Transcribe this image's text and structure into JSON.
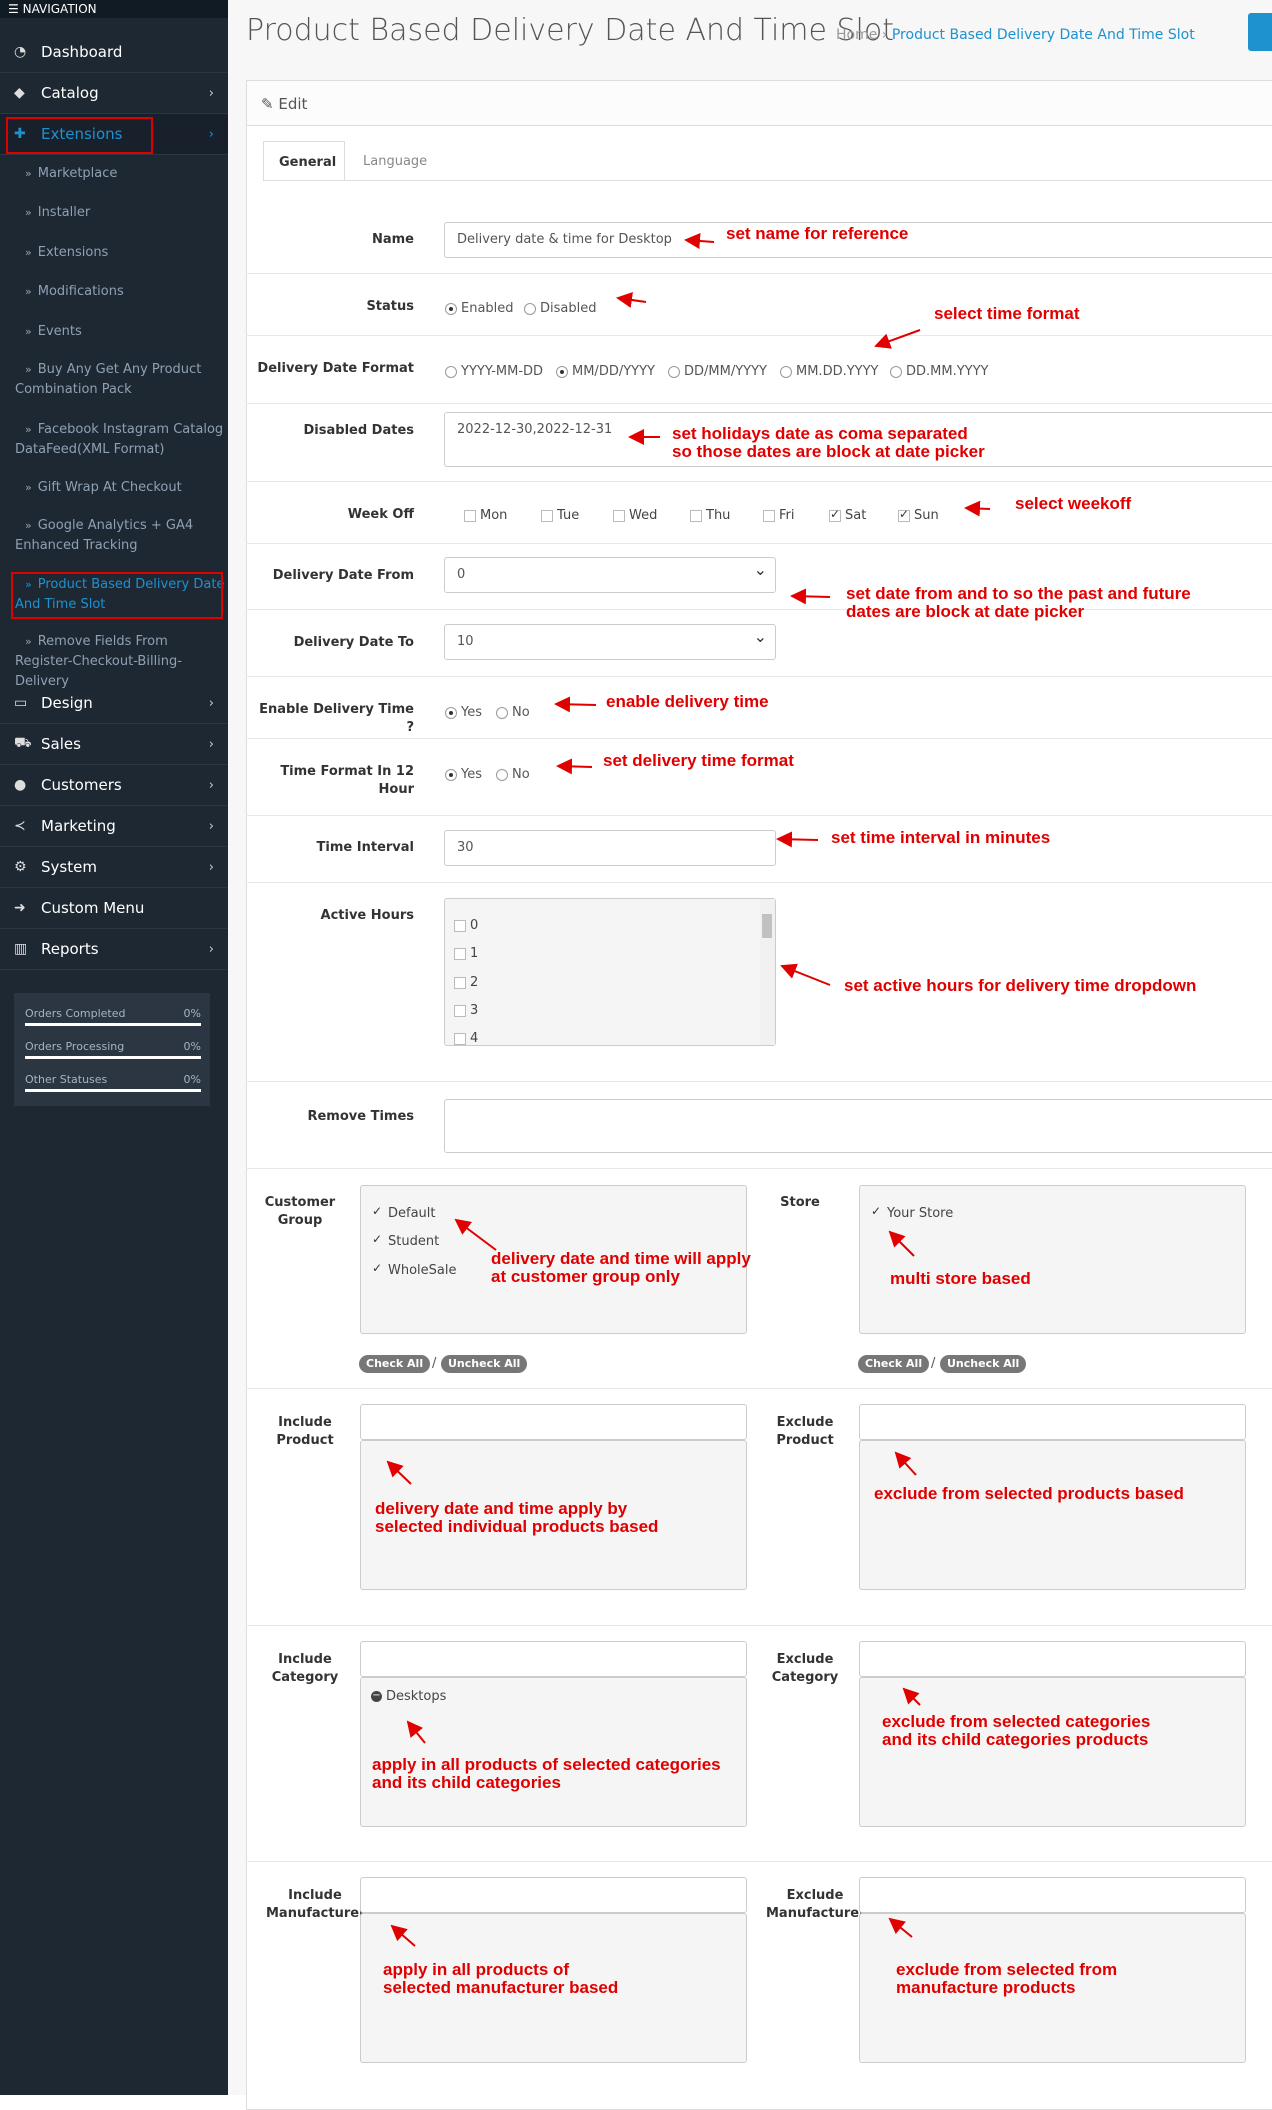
{
  "sidebar": {
    "nav_heading": "NAVIGATION",
    "menu": [
      {
        "label": "Dashboard",
        "icon": "dashboard-icon",
        "has_children": false
      },
      {
        "label": "Catalog",
        "icon": "tags-icon",
        "has_children": true
      },
      {
        "label": "Extensions",
        "icon": "puzzle-icon",
        "has_children": true
      },
      {
        "label": "Design",
        "icon": "desktop-icon",
        "has_children": true
      },
      {
        "label": "Sales",
        "icon": "cart-icon",
        "has_children": true
      },
      {
        "label": "Customers",
        "icon": "user-icon",
        "has_children": true
      },
      {
        "label": "Marketing",
        "icon": "share-icon",
        "has_children": true
      },
      {
        "label": "System",
        "icon": "gear-icon",
        "has_children": true
      },
      {
        "label": "Custom Menu",
        "icon": "arrow-right-icon",
        "has_children": false
      },
      {
        "label": "Reports",
        "icon": "bar-chart-icon",
        "has_children": true
      }
    ],
    "extensions_sub": [
      "Marketplace",
      "Installer",
      "Extensions",
      "Modifications",
      "Events",
      "Buy Any Get Any Product Combination Pack",
      "Facebook Instagram Catalog DataFeed(XML Format)",
      "Gift Wrap At Checkout",
      "Google Analytics + GA4 Enhanced Tracking",
      "Product Based Delivery Date And Time Slot",
      "Remove Fields From Register-Checkout-Billing-Delivery"
    ],
    "stats": [
      {
        "label": "Orders Completed",
        "value": "0%"
      },
      {
        "label": "Orders Processing",
        "value": "0%"
      },
      {
        "label": "Other Statuses",
        "value": "0%"
      }
    ]
  },
  "header": {
    "title": "Product Based Delivery Date And Time Slot",
    "breadcrumb": [
      "Home",
      "Product Based Delivery Date And Time Slot"
    ],
    "breadcrumb_sep": "›"
  },
  "panel": {
    "heading": "Edit",
    "tabs": [
      "General",
      "Language"
    ]
  },
  "form": {
    "name": {
      "label": "Name",
      "value": "Delivery date & time for Desktop"
    },
    "status": {
      "label": "Status",
      "options": [
        "Enabled",
        "Disabled"
      ],
      "selected": "Enabled"
    },
    "date_format": {
      "label": "Delivery Date Format",
      "options": [
        "YYYY-MM-DD",
        "MM/DD/YYYY",
        "DD/MM/YYYY",
        "MM.DD.YYYY",
        "DD.MM.YYYY"
      ],
      "selected": "MM/DD/YYYY"
    },
    "disabled_dates": {
      "label": "Disabled Dates",
      "value": "2022-12-30,2022-12-31"
    },
    "week_off": {
      "label": "Week Off",
      "days": [
        "Mon",
        "Tue",
        "Wed",
        "Thu",
        "Fri",
        "Sat",
        "Sun"
      ],
      "checked": [
        "Sat",
        "Sun"
      ]
    },
    "date_from": {
      "label": "Delivery Date From",
      "value": "0"
    },
    "date_to": {
      "label": "Delivery Date To",
      "value": "10"
    },
    "enable_time": {
      "label": "Enable Delivery Time ?",
      "options": [
        "Yes",
        "No"
      ],
      "selected": "Yes"
    },
    "time_format": {
      "label_line1": "Time Format In 12",
      "label_line2": "Hour",
      "options": [
        "Yes",
        "No"
      ],
      "selected": "Yes"
    },
    "time_interval": {
      "label": "Time Interval",
      "value": "30"
    },
    "active_hours": {
      "label": "Active Hours",
      "items": [
        "0",
        "1",
        "2",
        "3",
        "4"
      ]
    },
    "remove_times": {
      "label": "Remove Times",
      "value": ""
    },
    "customer_group": {
      "label_line1": "Customer",
      "label_line2": "Group",
      "items": [
        "Default",
        "Student",
        "WholeSale"
      ]
    },
    "store": {
      "label": "Store",
      "items": [
        "Your Store"
      ]
    },
    "check_all": "Check All",
    "uncheck_all": "Uncheck All",
    "slash": "/",
    "include_product": {
      "label_line1": "Include",
      "label_line2": "Product"
    },
    "exclude_product": {
      "label_line1": "Exclude",
      "label_line2": "Product"
    },
    "include_category": {
      "label_line1": "Include",
      "label_line2": "Category",
      "items": [
        "Desktops"
      ]
    },
    "exclude_category": {
      "label_line1": "Exclude",
      "label_line2": "Category"
    },
    "include_manufacturer": {
      "label_line1": "Include",
      "label_line2": "Manufacturer"
    },
    "exclude_manufacturer": {
      "label_line1": "Exclude",
      "label_line2": "Manufacturer"
    }
  },
  "annotations": {
    "name": "set name for reference",
    "time_format": "select time format",
    "holidays_1": "set holidays date as coma separated",
    "holidays_2": "so those dates are block at date picker",
    "weekoff": "select weekoff",
    "date_range_1": "set date from and to so the past and future",
    "date_range_2": "dates are block at date picker",
    "enable_time": "enable delivery time",
    "delivery_time_format": "set delivery time format",
    "interval": "set time interval in minutes",
    "active_hours": "set active hours for delivery time dropdown",
    "customer_group_1": "delivery date and time will apply",
    "customer_group_2": "at customer group only",
    "store": "multi store based",
    "include_product_1": "delivery date and time apply by",
    "include_product_2": "selected individual products based",
    "exclude_product": "exclude from selected products based",
    "include_category_1": "apply in all products of selected categories",
    "include_category_2": "and its child categories",
    "exclude_category_1": "exclude from selected categories",
    "exclude_category_2": "and its child categories products",
    "include_manufacturer_1": "apply in all products of",
    "include_manufacturer_2": "selected manufacturer based",
    "exclude_manufacturer_1": "exclude from selected from",
    "exclude_manufacturer_2": "manufacture products"
  },
  "colors": {
    "sidebar_bg": "#1e2833",
    "accent": "#1e91cf",
    "annotation": "#e00000"
  }
}
